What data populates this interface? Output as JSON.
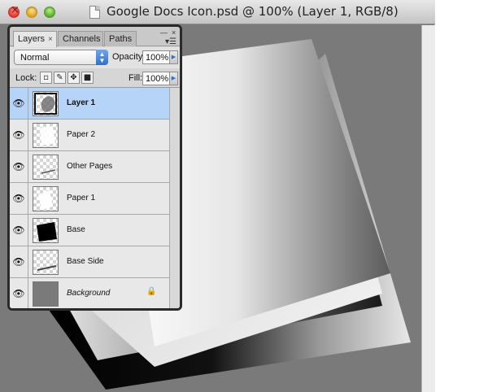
{
  "window": {
    "title": "Google Docs Icon.psd @ 100% (Layer 1, RGB/8)"
  },
  "panel": {
    "tabs": [
      {
        "label": "Layers",
        "active": true
      },
      {
        "label": "Channels",
        "active": false
      },
      {
        "label": "Paths",
        "active": false
      }
    ],
    "tab_close": "×",
    "collapse": "—",
    "close": "×",
    "menu": "▾☰",
    "blend_mode": "Normal",
    "opacity_label": "Opacity:",
    "opacity_value": "100%",
    "lock_label": "Lock:",
    "fill_label": "Fill:",
    "fill_value": "100%",
    "lock_icons": [
      "transparent-pixels-icon",
      "brush-icon",
      "move-icon",
      "lock-icon"
    ],
    "layers": [
      {
        "name": "Layer 1",
        "selected": true,
        "visible": true
      },
      {
        "name": "Paper 2",
        "selected": false,
        "visible": true
      },
      {
        "name": "Other Pages",
        "selected": false,
        "visible": true
      },
      {
        "name": "Paper 1",
        "selected": false,
        "visible": true
      },
      {
        "name": "Base",
        "selected": false,
        "visible": true
      },
      {
        "name": "Base Side",
        "selected": false,
        "visible": true
      },
      {
        "name": "Background",
        "selected": false,
        "visible": true,
        "locked": true
      }
    ]
  },
  "colors": {
    "canvas_bg": "#7a7a7a",
    "selected_layer": "#b6d3f8",
    "accent_blue": "#2f6fd0"
  }
}
